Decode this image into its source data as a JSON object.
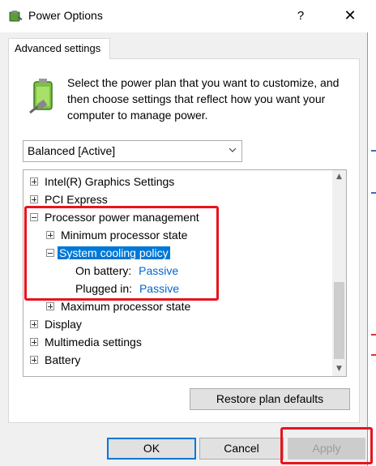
{
  "window": {
    "title": "Power Options",
    "help_label": "?",
    "close_label": "✕"
  },
  "tab": {
    "label": "Advanced settings"
  },
  "description": "Select the power plan that you want to customize, and then choose settings that reflect how you want your computer to manage power.",
  "plan_select": {
    "selected": "Balanced [Active]"
  },
  "tree": {
    "items": [
      {
        "label": "Intel(R) Graphics Settings"
      },
      {
        "label": "PCI Express"
      },
      {
        "label": "Processor power management"
      },
      {
        "label": "Minimum processor state"
      },
      {
        "label": "System cooling policy"
      },
      {
        "label": "On battery:",
        "value": "Passive"
      },
      {
        "label": "Plugged in:",
        "value": "Passive"
      },
      {
        "label": "Maximum processor state"
      },
      {
        "label": "Display"
      },
      {
        "label": "Multimedia settings"
      },
      {
        "label": "Battery"
      }
    ]
  },
  "buttons": {
    "restore": "Restore plan defaults",
    "ok": "OK",
    "cancel": "Cancel",
    "apply": "Apply"
  },
  "colors": {
    "highlight": "#e8141e",
    "selection": "#0078d7",
    "link": "#0066cc"
  }
}
